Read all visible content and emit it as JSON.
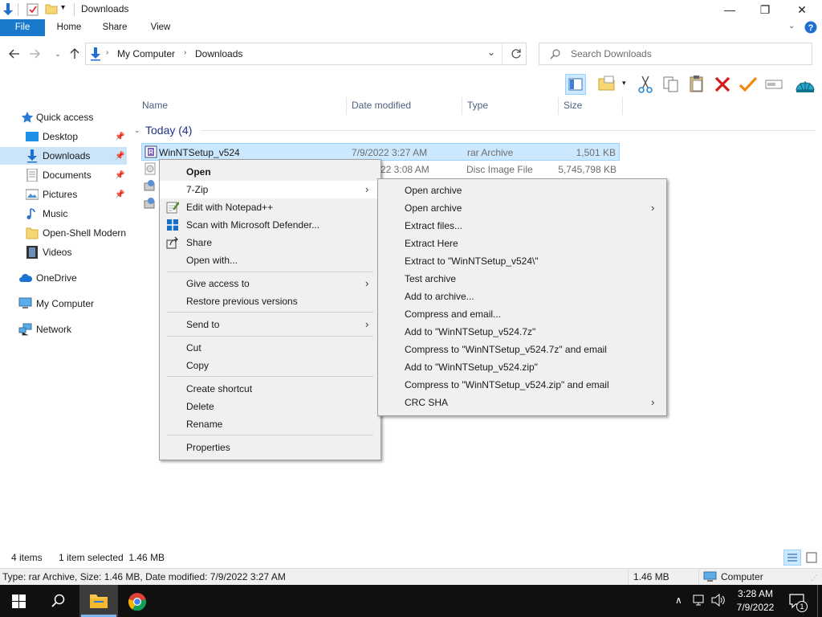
{
  "window": {
    "title": "Downloads",
    "minimize_glyph": "—",
    "maximize_glyph": "❐",
    "close_glyph": "✕"
  },
  "ribbon": {
    "tabs": [
      "File",
      "Home",
      "Share",
      "View"
    ]
  },
  "address": {
    "crumbs": [
      "My Computer",
      "Downloads"
    ],
    "search_placeholder": "Search Downloads"
  },
  "nav": {
    "items": [
      {
        "label": "Quick access",
        "icon": "star-icon"
      },
      {
        "label": "Desktop",
        "icon": "desktop-icon",
        "pinned": true
      },
      {
        "label": "Downloads",
        "icon": "download-arrow-icon",
        "pinned": true,
        "selected": true
      },
      {
        "label": "Documents",
        "icon": "documents-icon",
        "pinned": true
      },
      {
        "label": "Pictures",
        "icon": "pictures-icon",
        "pinned": true
      },
      {
        "label": "Music",
        "icon": "music-icon"
      },
      {
        "label": "Open-Shell Modern",
        "icon": "folder-icon"
      },
      {
        "label": "Videos",
        "icon": "videos-icon"
      },
      {
        "label": "OneDrive",
        "icon": "cloud-icon"
      },
      {
        "label": "My Computer",
        "icon": "computer-icon"
      },
      {
        "label": "Network",
        "icon": "network-icon"
      }
    ]
  },
  "columns": [
    "Name",
    "Date modified",
    "Type",
    "Size"
  ],
  "group": {
    "label": "Today (4)"
  },
  "files": [
    {
      "name": "WinNTSetup_v524",
      "date": "7/9/2022 3:27 AM",
      "type": "rar Archive",
      "size": "1,501 KB"
    },
    {
      "name": "",
      "date": "7/9/2022 3:08 AM",
      "date_visible": "22 3:08 AM",
      "type": "Disc Image File",
      "size": "5,745,798 KB"
    }
  ],
  "context_menu": {
    "groups": [
      [
        "Open",
        "7-Zip",
        "Edit with Notepad++",
        "Scan with Microsoft Defender...",
        "Share",
        "Open with..."
      ],
      [
        "Give access to",
        "Restore previous versions"
      ],
      [
        "Send to"
      ],
      [
        "Cut",
        "Copy"
      ],
      [
        "Create shortcut",
        "Delete",
        "Rename"
      ],
      [
        "Properties"
      ]
    ]
  },
  "submenu": {
    "items": [
      "Open archive",
      "Open archive",
      "Extract files...",
      "Extract Here",
      "Extract to \"WinNTSetup_v524\\\"",
      "Test archive",
      "Add to archive...",
      "Compress and email...",
      "Add to \"WinNTSetup_v524.7z\"",
      "Compress to \"WinNTSetup_v524.7z\" and email",
      "Add to \"WinNTSetup_v524.zip\"",
      "Compress to \"WinNTSetup_v524.zip\" and email",
      "CRC SHA"
    ]
  },
  "status": {
    "count": "4 items",
    "selection": "1 item selected  1.46 MB",
    "details": "Type: rar Archive, Size: 1.46 MB, Date modified: 7/9/2022 3:27 AM",
    "size": "1.46 MB",
    "location": "Computer"
  },
  "taskbar": {
    "time": "3:28 AM",
    "date": "7/9/2022",
    "notifications": "1"
  },
  "colors": {
    "accent": "#1979ca",
    "selection": "#cce8ff",
    "taskbar": "#101010"
  }
}
